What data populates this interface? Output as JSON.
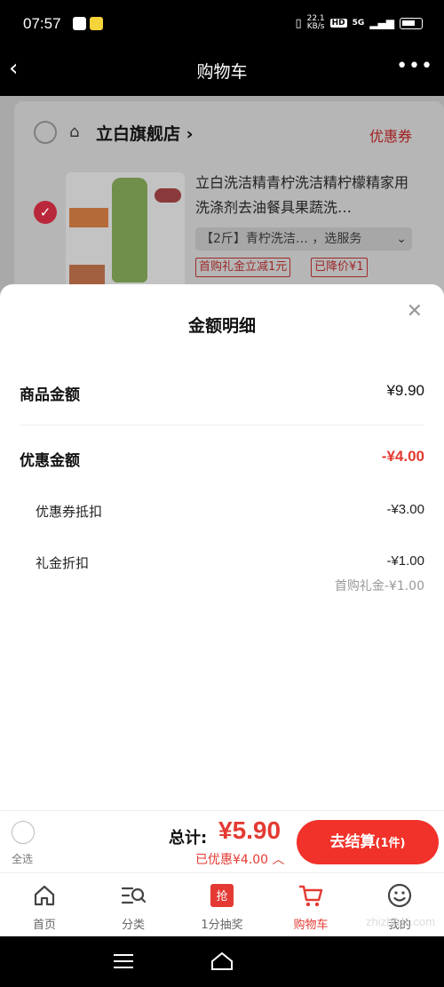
{
  "status_bar": {
    "time": "07:57",
    "net_speed": "22.1\nKB/s",
    "hd": "HD",
    "network": "5G"
  },
  "nav": {
    "title": "购物车",
    "back_icon": "chevron-left-icon",
    "more_icon": "more-dots-icon"
  },
  "store": {
    "name": "立白旗舰店",
    "chevron": "›",
    "coupon_label": "优惠券"
  },
  "product": {
    "title": "立白洗洁精青柠洗洁精柠檬精家用洗涤剂去油餐具果蔬洗…",
    "sku": "【2斤】青柠洗洁…  ，选服务",
    "tags": [
      "首购礼金立减1元",
      "已降价¥1"
    ]
  },
  "sheet": {
    "title": "金额明细",
    "goods_amount_label": "商品金额",
    "goods_amount_value": "¥9.90",
    "discount_label": "优惠金额",
    "discount_value": "-¥4.00",
    "coupon_label": "优惠券抵扣",
    "coupon_value": "-¥3.00",
    "gift_label": "礼金折扣",
    "gift_value": "-¥1.00",
    "gift_note": "首购礼金-¥1.00"
  },
  "checkout": {
    "select_all_label": "全选",
    "total_label": "总计:",
    "total_value": "¥5.90",
    "saved_label": "已优惠¥4.00",
    "pay_label": "去结算",
    "pay_count": "(1件)"
  },
  "tabs": [
    {
      "label": "首页",
      "icon": "home-icon"
    },
    {
      "label": "分类",
      "icon": "category-search-icon"
    },
    {
      "label": "1分抽奖",
      "icon": "grab-icon"
    },
    {
      "label": "购物车",
      "icon": "cart-icon",
      "active": true
    },
    {
      "label": "我的",
      "icon": "smiley-icon"
    }
  ],
  "watermark": "zhizhizhi.com",
  "colors": {
    "accent": "#e43a33",
    "primary_button": "#f0322a"
  }
}
